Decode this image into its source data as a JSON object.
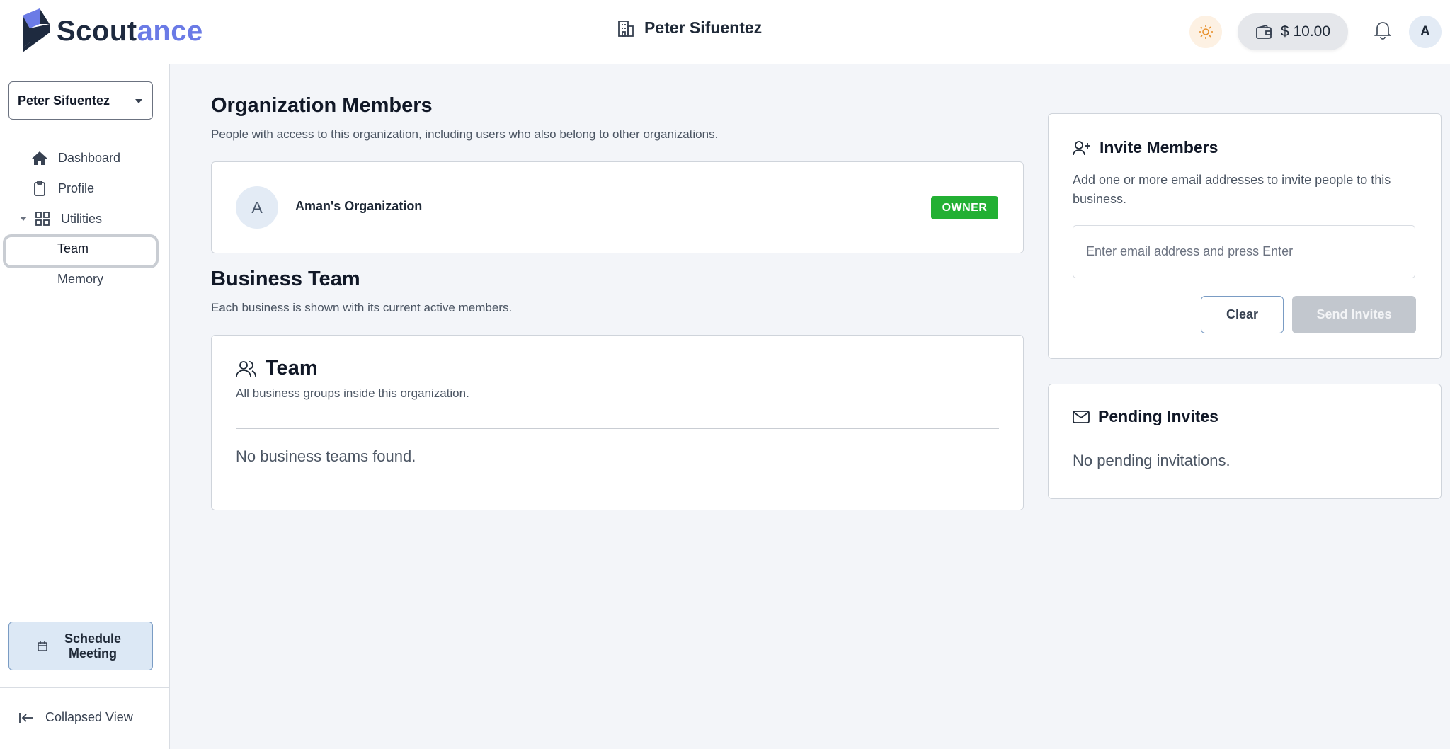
{
  "brand": {
    "name_part1": "Scout",
    "name_part2": "ance"
  },
  "header": {
    "org_title": "Peter Sifuentez",
    "wallet_amount": "$ 10.00",
    "avatar_initial": "A"
  },
  "sidebar": {
    "org_select": "Peter Sifuentez",
    "items": [
      {
        "label": "Dashboard",
        "icon": "home-icon"
      },
      {
        "label": "Profile",
        "icon": "clipboard-icon"
      },
      {
        "label": "Utilities",
        "icon": "grid-icon",
        "expanded": true
      },
      {
        "label": "Team",
        "active": true
      },
      {
        "label": "Memory"
      }
    ],
    "schedule_label": "Schedule Meeting",
    "collapsed_label": "Collapsed View"
  },
  "members": {
    "title": "Organization Members",
    "subtitle": "People with access to this organization, including users who also belong to other organizations.",
    "list": [
      {
        "initial": "A",
        "name": "Aman's Organization",
        "role": "OWNER"
      }
    ]
  },
  "business": {
    "title": "Business Team",
    "subtitle": "Each business is shown with its current active members.",
    "team_title": "Team",
    "team_subtitle": "All business groups inside this organization.",
    "empty": "No business teams found."
  },
  "invite": {
    "title": "Invite Members",
    "description": "Add one or more email addresses to invite people to this business.",
    "placeholder": "Enter email address and press Enter",
    "clear_label": "Clear",
    "send_label": "Send Invites"
  },
  "pending": {
    "title": "Pending Invites",
    "empty": "No pending invitations."
  },
  "colors": {
    "brand_dark": "#1e2a3f",
    "brand_accent": "#6b7be6",
    "owner_badge": "#22b033"
  }
}
